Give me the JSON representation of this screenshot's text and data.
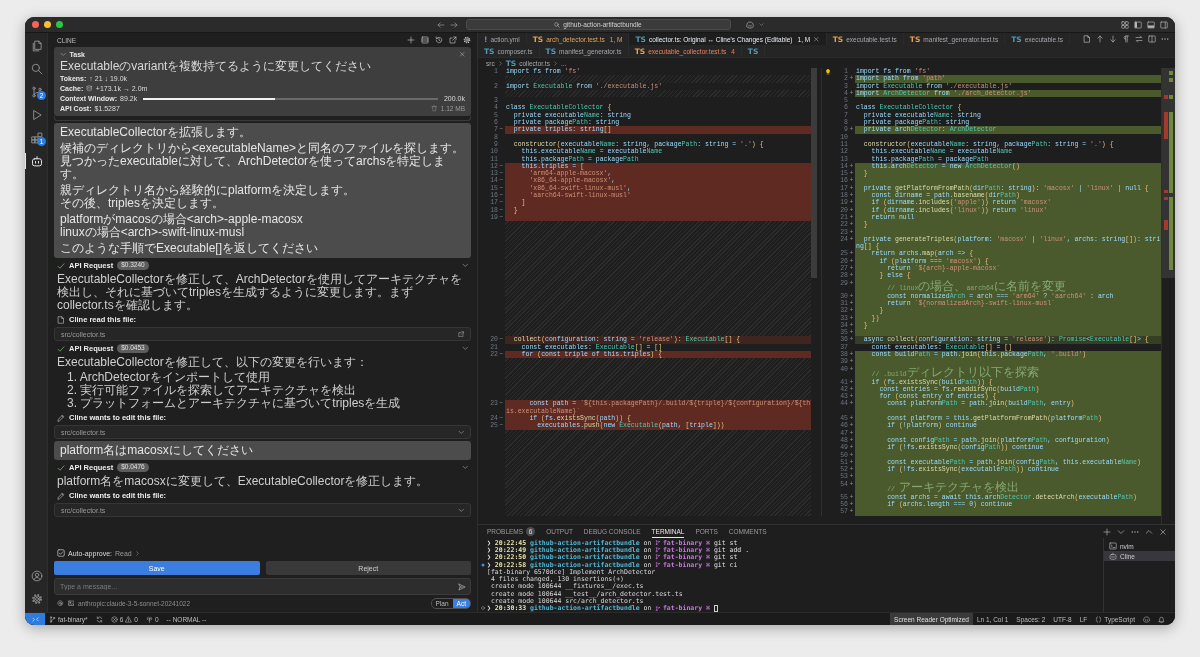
{
  "window": {
    "search": "github-action-artifactbundle"
  },
  "activity_bar": {
    "items": [
      {
        "kind": "files",
        "selected": false
      },
      {
        "kind": "search",
        "selected": false
      },
      {
        "kind": "source-control",
        "badge": "2",
        "selected": false
      },
      {
        "kind": "run",
        "selected": false
      },
      {
        "kind": "extensions",
        "badge": "1",
        "selected": false
      },
      {
        "kind": "cline",
        "selected": true
      }
    ],
    "bottom": [
      {
        "kind": "account"
      },
      {
        "kind": "settings"
      }
    ]
  },
  "sidebar": {
    "title": "CLINE",
    "task": {
      "heading": "Task",
      "expanded": true,
      "title": "Executableのvariantを複数持てるように変更してください",
      "tokens": {
        "label": "Tokens:",
        "value": "↑ 21 ↓ 19.0k"
      },
      "cache": {
        "label": "Cache:",
        "value": "+173.1k → 2.0m"
      },
      "context": {
        "label": "Context Window:",
        "used": "89.2k",
        "level": 0.446,
        "total": "200.0k"
      },
      "cost": {
        "label": "API Cost:",
        "value": "$1.5287",
        "size": "1.12 MB"
      }
    },
    "messages": [
      {
        "kind": "clipped"
      },
      {
        "kind": "user",
        "paragraphs": [
          [
            "ExecutableCollectorを拡張します。"
          ],
          [
            "候補のディレクトリから<executableName>と同名のファイルを探します。",
            "見つかったexecutableに対して、ArchDetectorを使ってarchsを特定します。"
          ],
          [
            "親ディレクトリ名から経験的にplatformを決定します。",
            "その後、triplesを決定します。"
          ],
          [
            "platformがmacosの場合<arch>-apple-macosx",
            "linuxの場合<arch>-swift-linux-musl"
          ],
          [
            "このような手順でExecutable[]を返してください"
          ]
        ]
      },
      {
        "kind": "api",
        "label": "API Request",
        "cost": "$0.3240",
        "done": true
      },
      {
        "kind": "text",
        "text": "ExecutableCollectorを修正して、ArchDetectorを使用してアーキテクチャを検出し、それに基づいてtriplesを生成するように変更します。まずcollector.tsを確認します。"
      },
      {
        "kind": "read",
        "label": "Cline read this file:",
        "path": "src/collector.ts"
      },
      {
        "kind": "api",
        "label": "API Request",
        "cost": "$0.0453",
        "done": true
      },
      {
        "kind": "text",
        "text": "ExecutableCollectorを修正して、以下の変更を行います：",
        "list": [
          "1. ArchDetectorをインポートして使用",
          "2. 実行可能ファイルを探索してアーキテクチャを検出",
          "3. プラットフォームとアーキテクチャに基づいてtriplesを生成"
        ]
      },
      {
        "kind": "edit",
        "label": "Cline wants to edit this file:",
        "path": "src/collector.ts"
      },
      {
        "kind": "user",
        "paragraphs": [
          [
            "platform名はmacosxにしてください"
          ]
        ]
      },
      {
        "kind": "api",
        "label": "API Request",
        "cost": "$0.0476",
        "done": true
      },
      {
        "kind": "text",
        "text": "platform名をmacosxに変更して、ExecutableCollectorを修正します。"
      },
      {
        "kind": "edit",
        "label": "Cline wants to edit this file:",
        "path": "src/collector.ts"
      }
    ],
    "auto_approve": {
      "checked": true,
      "label": "Auto-approve:",
      "value": "Read"
    },
    "buttons": [
      {
        "kind": "primary",
        "label": "Save"
      },
      {
        "kind": "secondary",
        "label": "Reject"
      }
    ],
    "input": {
      "placeholder": "Type a message..."
    },
    "model": "anthropic:claude-3-5-sonnet-20241022",
    "modes": [
      {
        "label": "Plan",
        "selected": false
      },
      {
        "label": "Act",
        "selected": true
      }
    ]
  },
  "editor": {
    "tabs": [
      {
        "icon": "!",
        "color": "#a074c4",
        "label": "action.yml",
        "kind": "normal",
        "selected": false
      },
      {
        "icon": "TS",
        "color": "#e8a04c",
        "label": "arch_detector.test.ts",
        "badge": "1, M",
        "kind": "modified",
        "selected": false
      },
      {
        "icon": "TS",
        "color": "#519aba",
        "label": "collector.ts: Original ↔ Cline's Changes (Editable)",
        "badge": "1, M",
        "kind": "normal",
        "selected": true
      },
      {
        "icon": "TS",
        "color": "#e8a04c",
        "label": "executable.test.ts",
        "kind": "normal",
        "selected": false
      },
      {
        "icon": "TS",
        "color": "#e8a04c",
        "label": "manifest_generator.test.ts",
        "kind": "normal",
        "selected": false
      },
      {
        "icon": "TS",
        "color": "#519aba",
        "label": "executable.ts",
        "kind": "normal",
        "selected": false
      },
      {
        "icon": "TS",
        "color": "#519aba",
        "label": "composer.ts",
        "kind": "normal",
        "selected": false
      },
      {
        "icon": "TS",
        "color": "#519aba",
        "label": "manifest_generator.ts",
        "kind": "normal",
        "selected": false
      },
      {
        "icon": "TS",
        "color": "#e8a04c",
        "label": "executable_collector.test.ts",
        "badge": "4",
        "kind": "error",
        "selected": false
      },
      {
        "icon": "TS",
        "color": "#519aba",
        "kind": "normal",
        "selected": false
      }
    ],
    "breadcrumb": [
      {
        "label": "src"
      },
      {
        "icon": "TS",
        "label": "collector.ts"
      },
      {
        "label": "..."
      }
    ],
    "rows": [
      {
        "left": {
          "n": "1",
          "kind": "same",
          "code": "import fs from 'fs'"
        },
        "right": {
          "n": "1",
          "kind": "same",
          "code": "import fs from 'fs'"
        }
      },
      {
        "right": {
          "n": "2",
          "mark": "+",
          "kind": "added",
          "code": "import path from 'path'"
        }
      },
      {
        "left": {
          "n": "2",
          "kind": "same",
          "code": "import Executable from './executable.js'"
        },
        "right": {
          "n": "3",
          "kind": "same",
          "code": "import Executable from './executable.js'"
        }
      },
      {
        "right": {
          "n": "4",
          "mark": "+",
          "kind": "added",
          "code": "import ArchDetector from './arch_detector.js'"
        }
      },
      {
        "left": {
          "n": "3",
          "kind": "same"
        },
        "right": {
          "n": "5",
          "kind": "same"
        }
      },
      {
        "left": {
          "n": "4",
          "kind": "same",
          "code": "class ExecutableCollector {"
        },
        "right": {
          "n": "6",
          "kind": "same",
          "code": "class ExecutableCollector {"
        }
      },
      {
        "left": {
          "n": "5",
          "kind": "same",
          "code": "  private executableName: string"
        },
        "right": {
          "n": "7",
          "kind": "same",
          "code": "  private executableName: string"
        }
      },
      {
        "left": {
          "n": "6",
          "kind": "same",
          "code": "  private packagePath: string"
        },
        "right": {
          "n": "8",
          "kind": "same",
          "code": "  private packagePath: string"
        }
      },
      {
        "left": {
          "n": "7",
          "mark": "−",
          "kind": "removed",
          "code": "  private triples: string[]"
        },
        "right": {
          "n": "9",
          "mark": "+",
          "kind": "added",
          "code": "  private archDetector: ArchDetector"
        }
      },
      {
        "left": {
          "n": "8",
          "kind": "same"
        },
        "right": {
          "n": "10",
          "kind": "same"
        }
      },
      {
        "left": {
          "n": "9",
          "kind": "same",
          "code": "  constructor(executableName: string, packagePath: string = '.') {"
        },
        "right": {
          "n": "11",
          "kind": "same",
          "code": "  constructor(executableName: string, packagePath: string = '.') {"
        }
      },
      {
        "left": {
          "n": "10",
          "kind": "same",
          "code": "    this.executableName = executableName"
        },
        "right": {
          "n": "12",
          "kind": "same",
          "code": "    this.executableName = executableName"
        }
      },
      {
        "left": {
          "n": "11",
          "kind": "same",
          "code": "    this.packagePath = packagePath"
        },
        "right": {
          "n": "13",
          "kind": "same",
          "code": "    this.packagePath = packagePath"
        }
      },
      {
        "left": {
          "n": "12",
          "mark": "−",
          "kind": "removed",
          "code": "    this.triples = ["
        },
        "right": {
          "n": "14",
          "mark": "+",
          "kind": "added",
          "code": "    this.archDetector = new ArchDetector()"
        }
      },
      {
        "left": {
          "n": "13",
          "mark": "−",
          "kind": "removed",
          "code": "      'arm64-apple-macosx',"
        },
        "right": {
          "n": "15",
          "mark": "+",
          "kind": "added",
          "code": "  }"
        }
      },
      {
        "left": {
          "n": "14",
          "mark": "−",
          "kind": "removed",
          "code": "      'x86_64-apple-macosx',"
        },
        "right": {
          "n": "16",
          "mark": "+",
          "kind": "added"
        }
      },
      {
        "left": {
          "n": "15",
          "mark": "−",
          "kind": "removed",
          "code": "      'x86_64-swift-linux-musl',"
        },
        "right": {
          "n": "17",
          "mark": "+",
          "kind": "added",
          "code": "  private getPlatformFromPath(dirPath: string): 'macosx' | 'linux' | null {"
        }
      },
      {
        "left": {
          "n": "16",
          "mark": "−",
          "kind": "removed",
          "code": "      'aarch64-swift-linux-musl'"
        },
        "right": {
          "n": "18",
          "mark": "+",
          "kind": "added",
          "code": "    const dirname = path.basename(dirPath)"
        }
      },
      {
        "left": {
          "n": "17",
          "mark": "−",
          "kind": "removed",
          "code": "    ]"
        },
        "right": {
          "n": "19",
          "mark": "+",
          "kind": "added",
          "code": "    if (dirname.includes('apple')) return 'macosx'"
        }
      },
      {
        "left": {
          "n": "18",
          "mark": "−",
          "kind": "removed",
          "code": "  }"
        },
        "right": {
          "n": "20",
          "mark": "+",
          "kind": "added",
          "code": "    if (dirname.includes('linux')) return 'linux'"
        }
      },
      {
        "left": {
          "n": "19",
          "mark": "−",
          "kind": "removed"
        },
        "right": {
          "n": "21",
          "mark": "+",
          "kind": "added",
          "code": "    return null"
        }
      },
      {
        "right": {
          "n": "22",
          "mark": "+",
          "kind": "added",
          "code": "  }"
        }
      },
      {
        "right": {
          "n": "23",
          "mark": "+",
          "kind": "added"
        }
      },
      {
        "right": {
          "n": "24",
          "mark": "+",
          "kind": "added",
          "code": "  private generateTriples(platform: 'macosx' | 'linux', archs: string[]): string[] {"
        }
      },
      {
        "right": {
          "n": "25",
          "mark": "+",
          "kind": "added",
          "code": "    return archs.map(arch => {"
        }
      },
      {
        "right": {
          "n": "26",
          "mark": "+",
          "kind": "added",
          "code": "      if (platform === 'macosx') {"
        }
      },
      {
        "right": {
          "n": "27",
          "mark": "+",
          "kind": "added",
          "code": "        return `${arch}-apple-macosx`"
        }
      },
      {
        "right": {
          "n": "28",
          "mark": "+",
          "kind": "added",
          "code": "      } else {"
        }
      },
      {
        "right": {
          "n": "29",
          "mark": "+",
          "kind": "added",
          "code": "        // linuxの場合、aarch64に名前を変更"
        }
      },
      {
        "right": {
          "n": "30",
          "mark": "+",
          "kind": "added",
          "code": "        const normalizedArch = arch === 'arm64' ? 'aarch64' : arch"
        }
      },
      {
        "right": {
          "n": "31",
          "mark": "+",
          "kind": "added",
          "code": "        return `${normalizedArch}-swift-linux-musl`"
        }
      },
      {
        "right": {
          "n": "32",
          "mark": "+",
          "kind": "added",
          "code": "      }"
        }
      },
      {
        "right": {
          "n": "33",
          "mark": "+",
          "kind": "added",
          "code": "    })"
        }
      },
      {
        "right": {
          "n": "34",
          "mark": "+",
          "kind": "added",
          "code": "  }"
        }
      },
      {
        "right": {
          "n": "35",
          "mark": "+",
          "kind": "added"
        }
      },
      {
        "left": {
          "n": "20",
          "mark": "−",
          "kind": "changed",
          "code": "  collect(configuration: string = 'release'): Executable[] {"
        },
        "right": {
          "n": "36",
          "mark": "+",
          "kind": "changed",
          "code": "  async collect(configuration: string = 'release'): Promise<Executable[]> {"
        }
      },
      {
        "left": {
          "n": "21",
          "kind": "same",
          "code": "    const executables: Executable[] = []"
        },
        "right": {
          "n": "37",
          "kind": "same",
          "code": "    const executables: Executable[] = []"
        }
      },
      {
        "left": {
          "n": "22",
          "mark": "−",
          "kind": "removed",
          "code": "    for (const triple of this.triples) {"
        },
        "right": {
          "n": "38",
          "mark": "+",
          "kind": "added",
          "code": "    const buildPath = path.join(this.packagePath, '.build')"
        }
      },
      {
        "right": {
          "n": "39",
          "mark": "+",
          "kind": "added"
        }
      },
      {
        "right": {
          "n": "40",
          "mark": "+",
          "kind": "added",
          "code": "    // .buildディレクトリ以下を探索"
        }
      },
      {
        "right": {
          "n": "41",
          "mark": "+",
          "kind": "added",
          "code": "    if (fs.existsSync(buildPath)) {"
        }
      },
      {
        "right": {
          "n": "42",
          "mark": "+",
          "kind": "added",
          "code": "      const entries = fs.readdirSync(buildPath)"
        }
      },
      {
        "right": {
          "n": "43",
          "mark": "+",
          "kind": "added",
          "code": "      for (const entry of entries) {"
        }
      },
      {
        "left": {
          "n": "23",
          "mark": "−",
          "kind": "removed",
          "code": "      const path = `${this.packagePath}/.build/${triple}/${configuration}/${this.executableName}`"
        },
        "right": {
          "n": "44",
          "mark": "+",
          "kind": "added",
          "code": "        const platformPath = path.join(buildPath, entry)"
        }
      },
      {
        "left": {
          "n": "24",
          "mark": "−",
          "kind": "removed",
          "code": "      if (fs.existsSync(path)) {"
        },
        "right": {
          "n": "45",
          "mark": "+",
          "kind": "added",
          "code": "        const platform = this.getPlatformFromPath(platformPath)"
        }
      },
      {
        "left": {
          "n": "25",
          "mark": "−",
          "kind": "removed",
          "code": "        executables.push(new Executable(path, [triple]))"
        },
        "right": {
          "n": "46",
          "mark": "+",
          "kind": "added",
          "code": "        if (!platform) continue"
        }
      },
      {
        "right": {
          "n": "47",
          "mark": "+",
          "kind": "added"
        }
      },
      {
        "right": {
          "n": "48",
          "mark": "+",
          "kind": "added",
          "code": "        const configPath = path.join(platformPath, configuration)"
        }
      },
      {
        "right": {
          "n": "49",
          "mark": "+",
          "kind": "added",
          "code": "        if (!fs.existsSync(configPath)) continue"
        }
      },
      {
        "right": {
          "n": "50",
          "mark": "+",
          "kind": "added"
        }
      },
      {
        "right": {
          "n": "51",
          "mark": "+",
          "kind": "added",
          "code": "        const executablePath = path.join(configPath, this.executableName)"
        }
      },
      {
        "right": {
          "n": "52",
          "mark": "+",
          "kind": "added",
          "code": "        if (!fs.existsSync(executablePath)) continue"
        }
      },
      {
        "right": {
          "n": "53",
          "mark": "+",
          "kind": "added"
        }
      },
      {
        "right": {
          "n": "54",
          "mark": "+",
          "kind": "added",
          "code": "        // アーキテクチャを検出"
        }
      },
      {
        "right": {
          "n": "55",
          "mark": "+",
          "kind": "added",
          "code": "        const archs = await this.archDetector.detectArch(executablePath)"
        }
      },
      {
        "right": {
          "n": "56",
          "mark": "+",
          "kind": "added",
          "code": "        if (archs.length === 0) continue"
        }
      },
      {
        "right": {
          "n": "57",
          "mark": "+",
          "kind": "added"
        }
      }
    ]
  },
  "panel": {
    "tabs": [
      {
        "label": "PROBLEMS",
        "badge": "6",
        "selected": false
      },
      {
        "label": "OUTPUT",
        "selected": false
      },
      {
        "label": "DEBUG CONSOLE",
        "selected": false
      },
      {
        "label": "TERMINAL",
        "selected": true
      },
      {
        "label": "PORTS",
        "selected": false
      },
      {
        "label": "COMMENTS",
        "selected": false
      }
    ],
    "terminal": [
      {
        "kind": "prompt",
        "symbol": "❯",
        "time": "20:22:45",
        "dir": "github-action-artifactbundle",
        "on": "on",
        "branch": "fat-binary ⌘",
        "command": "git st",
        "cursor": false
      },
      {
        "kind": "prompt",
        "symbol": "❯",
        "time": "20:22:49",
        "dir": "github-action-artifactbundle",
        "on": "on",
        "branch": "fat-binary ⌘",
        "command": "git add .",
        "cursor": false
      },
      {
        "kind": "prompt",
        "symbol": "❯",
        "time": "20:22:50",
        "dir": "github-action-artifactbundle",
        "on": "on",
        "branch": "fat-binary ⌘",
        "command": "git st",
        "cursor": false
      },
      {
        "kind": "prompt",
        "marker": {
          "kind": "dot"
        },
        "symbol": "❯",
        "time": "20:22:58",
        "dir": "github-action-artifactbundle",
        "on": "on",
        "branch": "fat-binary ⌘",
        "command": "git ci",
        "cursor": false
      },
      {
        "kind": "output",
        "text": "[fat-binary 6570dce] Implement ArchDetector"
      },
      {
        "kind": "output",
        "text": " 4 files changed, 130 insertions(+)"
      },
      {
        "kind": "output",
        "text": " create mode 100644 __fixtures__/exec.ts"
      },
      {
        "kind": "output",
        "text": " create mode 100644 __test__/arch_detector.test.ts"
      },
      {
        "kind": "output",
        "text": " create mode 100644 src/arch_detector.ts"
      },
      {
        "kind": "prompt",
        "marker": {
          "kind": "ring"
        },
        "symbol": "❯",
        "time": "20:30:33",
        "dir": "github-action-artifactbundle",
        "on": "on",
        "branch": "fat-binary ⌘",
        "cursor": true
      }
    ],
    "sessions": [
      {
        "kind": "shell",
        "label": "nvim",
        "selected": false
      },
      {
        "kind": "cline",
        "label": "Cline",
        "selected": true
      }
    ]
  },
  "status_bar": {
    "left": [
      {
        "kind": "remote"
      },
      {
        "kind": "branch",
        "text": "fat-binary*"
      },
      {
        "kind": "sync"
      },
      {
        "kind": "problems",
        "errors": "6",
        "warnings": "0"
      },
      {
        "kind": "ports",
        "text": "0"
      },
      {
        "kind": "text",
        "text": "-- NORMAL --"
      }
    ],
    "right": [
      {
        "kind": "accent",
        "text": "Screen Reader Optimized"
      },
      {
        "kind": "text",
        "text": "Ln 1, Col 1"
      },
      {
        "kind": "text",
        "text": "Spaces: 2"
      },
      {
        "kind": "text",
        "text": "UTF-8"
      },
      {
        "kind": "text",
        "text": "LF"
      },
      {
        "kind": "language",
        "text": "TypeScript"
      },
      {
        "kind": "copilot"
      },
      {
        "kind": "bell"
      }
    ]
  }
}
